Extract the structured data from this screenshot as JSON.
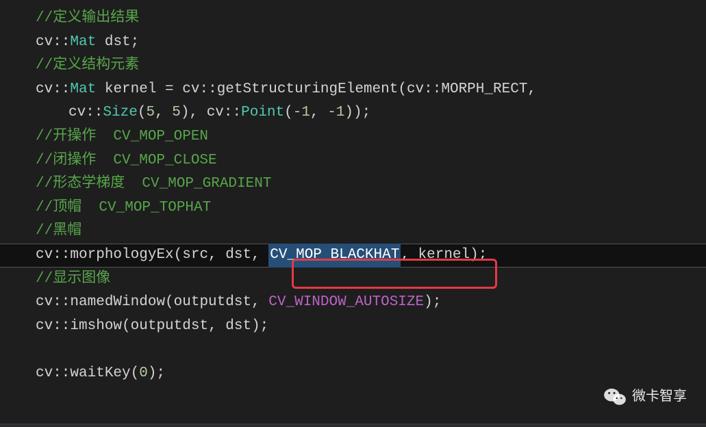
{
  "code": {
    "line1_comment": "//定义输出结果",
    "line2_ns": "cv::",
    "line2_type": "Mat",
    "line2_rest": " dst;",
    "line3_comment": "//定义结构元素",
    "line4_ns1": "cv::",
    "line4_type": "Mat",
    "line4_var": " kernel = ",
    "line4_ns2": "cv::",
    "line4_func": "getStructuringElement",
    "line4_p1": "(",
    "line4_ns3": "cv::",
    "line4_const": "MORPH_RECT",
    "line4_comma": ",",
    "line5_ns1": "cv::",
    "line5_func1": "Size",
    "line5_p1": "(",
    "line5_n1": "5",
    "line5_c1": ", ",
    "line5_n2": "5",
    "line5_p2": "), ",
    "line5_ns2": "cv::",
    "line5_func2": "Point",
    "line5_p3": "(",
    "line5_n3": "-1",
    "line5_c2": ", ",
    "line5_n4": "-1",
    "line5_p4": "));",
    "line6_comment": "//开操作  CV_MOP_OPEN",
    "line7_comment": "//闭操作  CV_MOP_CLOSE",
    "line8_comment": "//形态学梯度  CV_MOP_GRADIENT",
    "line9_comment": "//顶帽  CV_MOP_TOPHAT",
    "line10_comment": "//黑帽",
    "line11_ns": "cv::",
    "line11_func": "morphologyEx",
    "line11_p1": "(src, dst, ",
    "line11_selected": "CV_MOP_BLACKHAT",
    "line11_p2": ", kernel);",
    "line12_comment": "//显示图像",
    "line13_ns": "cv::",
    "line13_func": "namedWindow",
    "line13_p1": "(outputdst, ",
    "line13_const": "CV_WINDOW_AUTOSIZE",
    "line13_p2": ");",
    "line14_ns": "cv::",
    "line14_func": "imshow",
    "line14_p": "(outputdst, dst);",
    "line16_ns": "cv::",
    "line16_func": "waitKey",
    "line16_p1": "(",
    "line16_n": "0",
    "line16_p2": ");"
  },
  "watermark": {
    "text": "微卡智享"
  }
}
